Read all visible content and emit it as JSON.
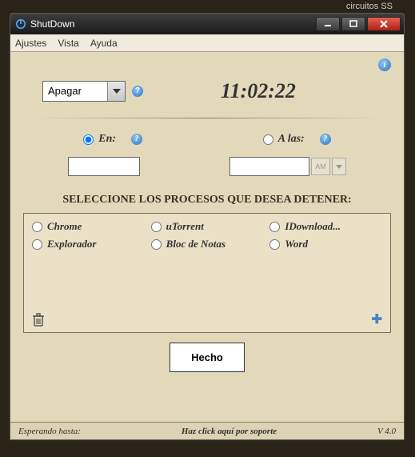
{
  "bg": {
    "tab": "circuitos SS"
  },
  "window": {
    "title": "ShutDown"
  },
  "menu": {
    "ajustes": "Ajustes",
    "vista": "Vista",
    "ayuda": "Ayuda"
  },
  "action": {
    "combo": "Apagar"
  },
  "clock": "11:02:22",
  "mode": {
    "en": "En:",
    "alas": "A las:",
    "am": "AM"
  },
  "section": {
    "title": "SELECCIONE LOS PROCESOS QUE DESEA DETENER:"
  },
  "proc": {
    "chrome": "Chrome",
    "utorrent": "uTorrent",
    "idownload": "IDownload...",
    "explorador": "Explorador",
    "bloc": "Bloc de Notas",
    "word": "Word"
  },
  "done": "Hecho",
  "status": {
    "left": "Esperando hasta:",
    "center": "Haz click aquí por soporte",
    "right": "V 4.0"
  }
}
